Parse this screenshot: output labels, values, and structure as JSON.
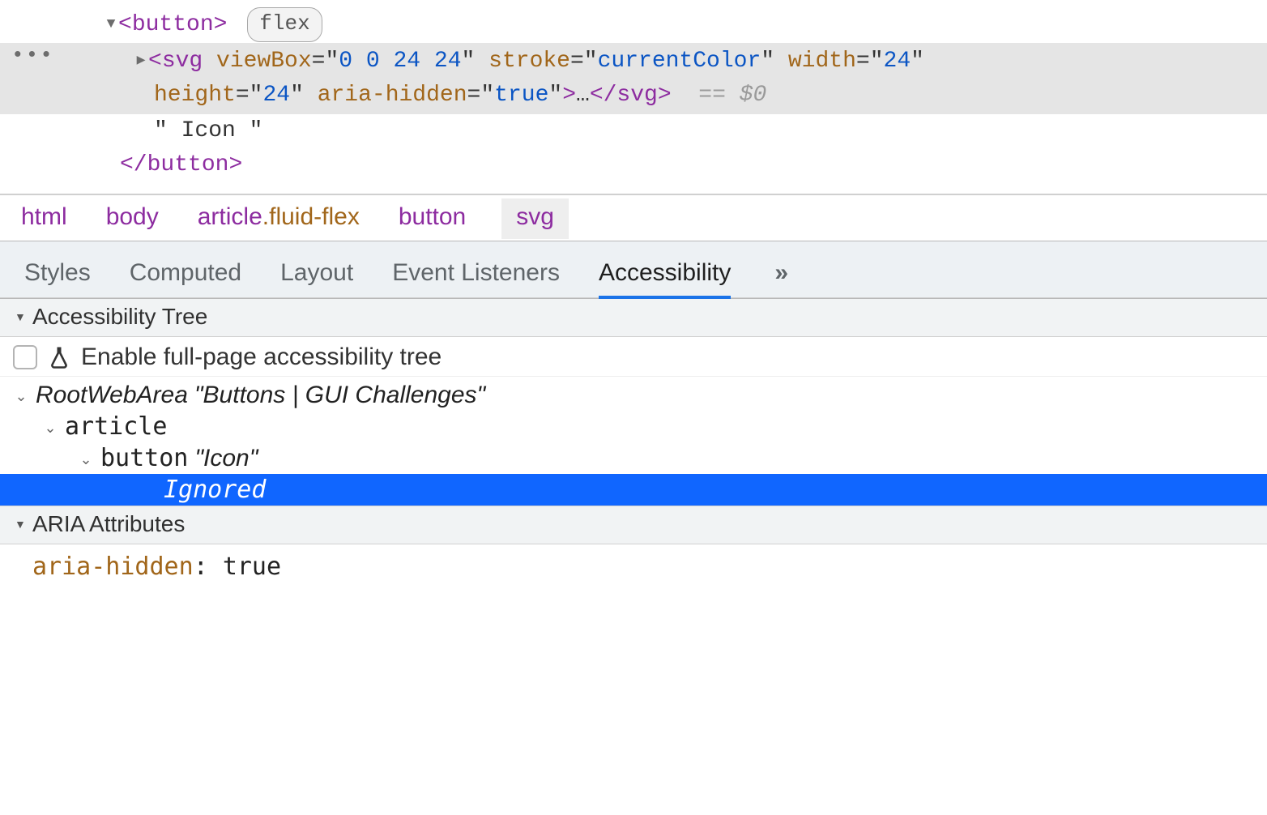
{
  "dom": {
    "button_open": "<button>",
    "flex_badge": "flex",
    "svg_tag": "svg",
    "svg_attrs": [
      {
        "name": "viewBox",
        "value": "0 0 24 24"
      },
      {
        "name": "stroke",
        "value": "currentColor"
      },
      {
        "name": "width",
        "value": "24"
      },
      {
        "name": "height",
        "value": "24"
      },
      {
        "name": "aria-hidden",
        "value": "true"
      }
    ],
    "svg_collapsed": "…",
    "svg_close": "</svg>",
    "ref": "== $0",
    "text_node": "\" Icon \"",
    "button_close": "</button>"
  },
  "breadcrumbs": [
    "html",
    "body",
    "article.fluid-flex",
    "button",
    "svg"
  ],
  "subtabs": {
    "items": [
      "Styles",
      "Computed",
      "Layout",
      "Event Listeners",
      "Accessibility"
    ],
    "active": 4,
    "more": "»"
  },
  "a11y": {
    "tree_header": "Accessibility Tree",
    "enable_label": "Enable full-page accessibility tree",
    "nodes": {
      "root_role": "RootWebArea",
      "root_name": "\"Buttons | GUI Challenges\"",
      "article_role": "article",
      "button_role": "button",
      "button_name": "\"Icon\"",
      "ignored": "Ignored"
    },
    "aria_header": "ARIA Attributes",
    "aria_attrs": {
      "key": "aria-hidden",
      "value": "true"
    }
  }
}
